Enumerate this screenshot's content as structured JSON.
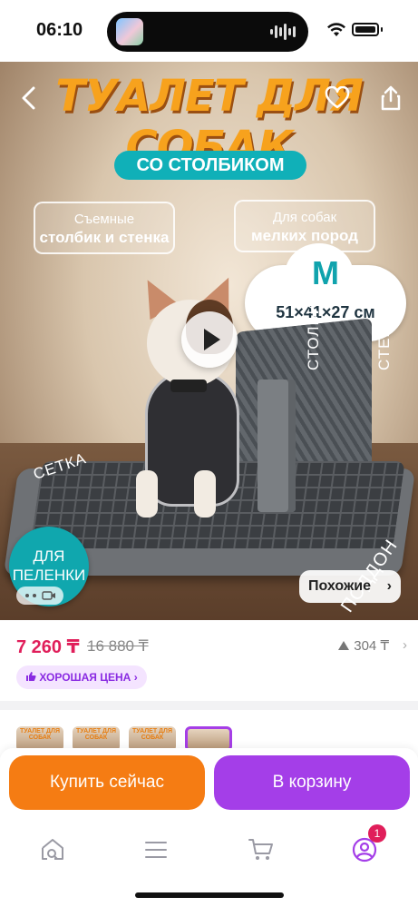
{
  "status_bar": {
    "time": "06:10"
  },
  "product_image": {
    "title": "ТУАЛЕТ ДЛЯ СОБАК",
    "subtitle": "СО СТОЛБИКОМ",
    "feature_1_line1": "Съемные",
    "feature_1_line2": "столбик и стенка",
    "feature_2_line1": "Для собак",
    "feature_2_line2": "мелких пород",
    "size_letter": "M",
    "size_dims": "51×41×27 см",
    "label_post": "СТОЛБИК",
    "label_wall": "СТЕНКА",
    "label_grid": "СЕТКА",
    "label_tray": "ПОДДОН",
    "badge_line1": "ДЛЯ",
    "badge_line2": "ПЕЛЕНКИ"
  },
  "similar_button": {
    "label": "Похожие"
  },
  "price": {
    "current": "7 260 ₸",
    "old": "16 880 ₸",
    "rating_count": "304 ₸",
    "good_price_label": "ХОРОШАЯ ЦЕНА"
  },
  "thumbnails": [
    {
      "text": "ТУАЛЕТ ДЛЯ СОБАК"
    },
    {
      "text": "ТУАЛЕТ ДЛЯ СОБАК"
    },
    {
      "text": "ТУАЛЕТ ДЛЯ СОБАК"
    },
    {
      "text": ""
    }
  ],
  "actions": {
    "buy_now": "Купить сейчас",
    "add_to_cart": "В корзину"
  },
  "tab_bar": {
    "profile_badge": "1"
  },
  "colors": {
    "price": "#e01e5a",
    "buy": "#f57c13",
    "cart": "#a43ee8",
    "accent_purple": "#8a2be2",
    "teal": "#10b0b8"
  }
}
